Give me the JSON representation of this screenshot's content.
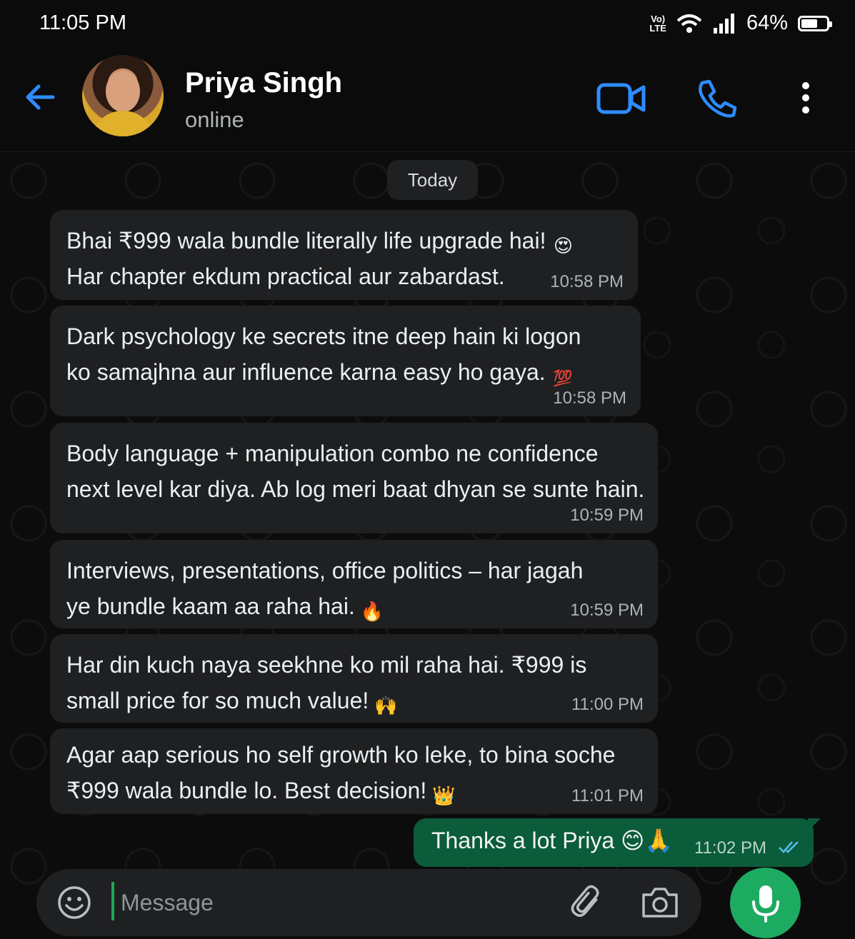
{
  "status_bar": {
    "time": "11:05 PM",
    "volte_top": "Vo)",
    "volte_bottom": "LTE",
    "battery_percent": "64%",
    "battery_level": 0.64
  },
  "header": {
    "contact_name": "Priya Singh",
    "contact_status": "online",
    "icons": [
      "back-arrow-icon",
      "video-call-icon",
      "voice-call-icon",
      "more-options-icon"
    ],
    "accent_color": "#2d8cff"
  },
  "chat": {
    "date_label": "Today",
    "incoming": [
      {
        "lines": [
          "Bhai ₹999 wala bundle literally life upgrade hai!",
          "Har chapter ekdum practical aur zabardast."
        ],
        "emoji": "😍",
        "time": "10:58 PM"
      },
      {
        "lines": [
          "Dark psychology ke secrets itne deep hain ki logon",
          "ko samajhna aur influence karna easy ho gaya."
        ],
        "emoji": "💯",
        "time": "10:58 PM"
      },
      {
        "lines": [
          "Body language + manipulation combo ne confidence",
          "next level kar diya. Ab log meri baat dhyan se sunte hain."
        ],
        "emoji": "",
        "time": "10:59 PM"
      },
      {
        "lines": [
          "Interviews, presentations, office politics – har jagah",
          "ye bundle kaam aa raha hai."
        ],
        "emoji": "🔥",
        "time": "10:59 PM"
      },
      {
        "lines": [
          "Har din kuch naya seekhne ko mil raha hai. ₹999 is",
          "small price for so much value!"
        ],
        "emoji": "🙌",
        "time": "11:00 PM"
      },
      {
        "lines": [
          "Agar aap serious ho self growth ko leke, to bina soche",
          "₹999 wala bundle lo. Best decision!"
        ],
        "emoji": "👑",
        "time": "11:01 PM"
      }
    ],
    "outgoing": {
      "text": "Thanks a lot Priya",
      "emojis": "😊🙏",
      "time": "11:02 PM",
      "read_status": "double-tick-read-icon"
    },
    "colors": {
      "incoming_bubble": "#1f2022",
      "outgoing_bubble": "#0b5c3b"
    }
  },
  "composer": {
    "placeholder": "Message",
    "icons": [
      "emoji-icon",
      "attach-icon",
      "camera-icon",
      "mic-icon"
    ],
    "mic_color": "#1daa61"
  }
}
